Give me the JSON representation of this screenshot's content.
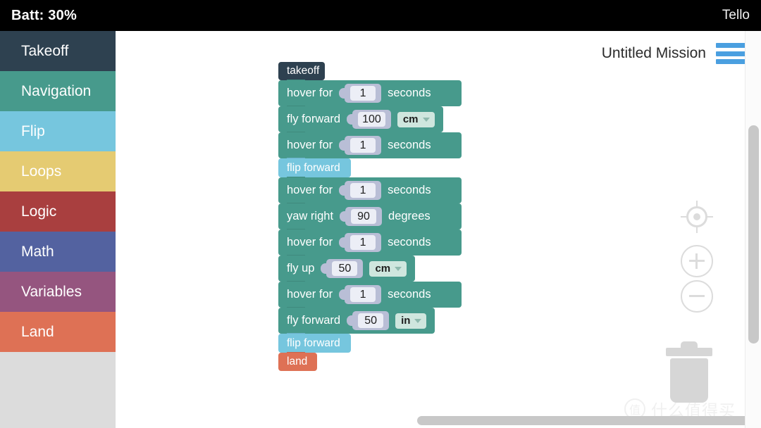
{
  "status_bar": {
    "battery_label": "Batt: 30%",
    "device_name": "Tello"
  },
  "sidebar": {
    "items": [
      {
        "label": "Takeoff",
        "color": "#2e4150"
      },
      {
        "label": "Navigation",
        "color": "#479a8c"
      },
      {
        "label": "Flip",
        "color": "#76c6de"
      },
      {
        "label": "Loops",
        "color": "#e5cb72"
      },
      {
        "label": "Logic",
        "color": "#a93f3f"
      },
      {
        "label": "Math",
        "color": "#5362a0"
      },
      {
        "label": "Variables",
        "color": "#95557f"
      },
      {
        "label": "Land",
        "color": "#de7155"
      }
    ],
    "empty_background": "#dcdcdc"
  },
  "header": {
    "mission_title": "Untitled Mission",
    "menu_icon": "hamburger-menu-icon",
    "menu_color": "#4a9fe0"
  },
  "program": {
    "blocks": [
      {
        "kind": "hat",
        "label": "takeoff"
      },
      {
        "kind": "value",
        "label": "hover for",
        "value": "1",
        "suffix": "seconds"
      },
      {
        "kind": "unit",
        "label": "fly forward",
        "value": "100",
        "unit": "cm"
      },
      {
        "kind": "value",
        "label": "hover for",
        "value": "1",
        "suffix": "seconds"
      },
      {
        "kind": "flip",
        "label": "flip forward"
      },
      {
        "kind": "value",
        "label": "hover for",
        "value": "1",
        "suffix": "seconds"
      },
      {
        "kind": "value",
        "label": "yaw right",
        "value": "90",
        "suffix": "degrees"
      },
      {
        "kind": "value",
        "label": "hover for",
        "value": "1",
        "suffix": "seconds"
      },
      {
        "kind": "unit",
        "label": "fly up",
        "value": "50",
        "unit": "cm"
      },
      {
        "kind": "value",
        "label": "hover for",
        "value": "1",
        "suffix": "seconds"
      },
      {
        "kind": "unit",
        "label": "fly forward",
        "value": "50",
        "unit": "in"
      },
      {
        "kind": "flip",
        "label": "flip forward"
      },
      {
        "kind": "end",
        "label": "land"
      }
    ],
    "colors": {
      "takeoff": "#2e4150",
      "navigation": "#479a8c",
      "flip": "#76c6de",
      "land": "#de7155",
      "slot": "#b9bed6",
      "slot_inner": "#eceef6",
      "unit_dropdown": "#cfe6de"
    }
  },
  "canvas_controls": {
    "recenter": "target-crosshair-icon",
    "zoom_in": "plus-icon",
    "zoom_out": "minus-icon",
    "trash": "trash-can-icon"
  },
  "watermark": {
    "badge": "值",
    "text": "什么值得买"
  }
}
